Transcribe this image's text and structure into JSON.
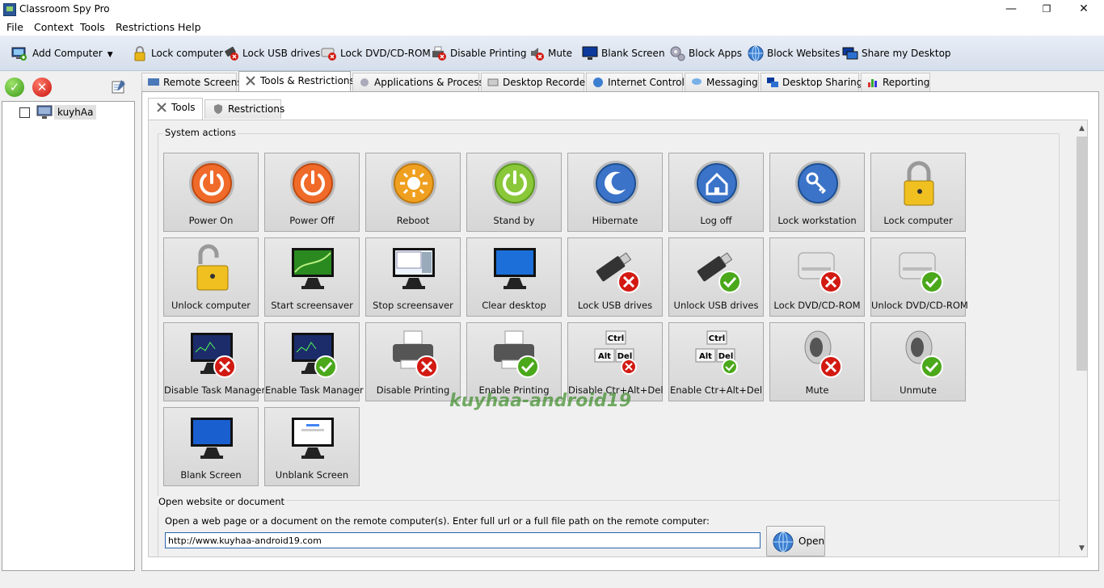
{
  "app": {
    "title": "Classroom Spy Pro",
    "minimize": "—",
    "maximize": "❐",
    "close": "✕"
  },
  "menu": [
    "File",
    "Context",
    "Tools",
    "Restrictions",
    "Help"
  ],
  "toolbar": {
    "add_computer": "Add Computer",
    "items": [
      "Lock computer",
      "Lock USB drives",
      "Lock DVD/CD-ROM",
      "Disable Printing",
      "Mute",
      "Blank Screen",
      "Block Apps",
      "Block Websites",
      "Share my Desktop"
    ]
  },
  "tree": {
    "computer": "kuyhAa"
  },
  "tabs": [
    "Remote Screens",
    "Tools & Restrictions",
    "Applications & Processes",
    "Desktop Recorder",
    "Internet Control",
    "Messaging",
    "Desktop Sharing",
    "Reporting"
  ],
  "subtabs": [
    "Tools",
    "Restrictions"
  ],
  "system_actions": {
    "label": "System actions",
    "buttons": [
      "Power On",
      "Power Off",
      "Reboot",
      "Stand by",
      "Hibernate",
      "Log off",
      "Lock workstation",
      "Lock computer",
      "Unlock computer",
      "Start screensaver",
      "Stop screensaver",
      "Clear desktop",
      "Lock USB drives",
      "Unlock USB drives",
      "Lock DVD/CD-ROM",
      "Unlock DVD/CD-ROM",
      "Disable Task Manager",
      "Enable Task Manager",
      "Disable Printing",
      "Enable Printing",
      "Disable Ctr+Alt+Del",
      "Enable Ctr+Alt+Del",
      "Mute",
      "Unmute",
      "Blank Screen",
      "Unblank Screen"
    ]
  },
  "open": {
    "title": "Open website or document",
    "description": "Open a web page or a document on the remote computer(s). Enter full url or a full file path on the remote computer:",
    "url": "http://www.kuyhaa-android19.com",
    "button": "Open"
  },
  "watermark": "kuyhaa-android19",
  "ctrl_key_labels": {
    "ctrl": "Ctrl",
    "alt": "Alt",
    "del": "Del"
  },
  "colors": {
    "accent": "#2a64b0",
    "ok": "#3a9a16",
    "bad": "#c9120c"
  }
}
